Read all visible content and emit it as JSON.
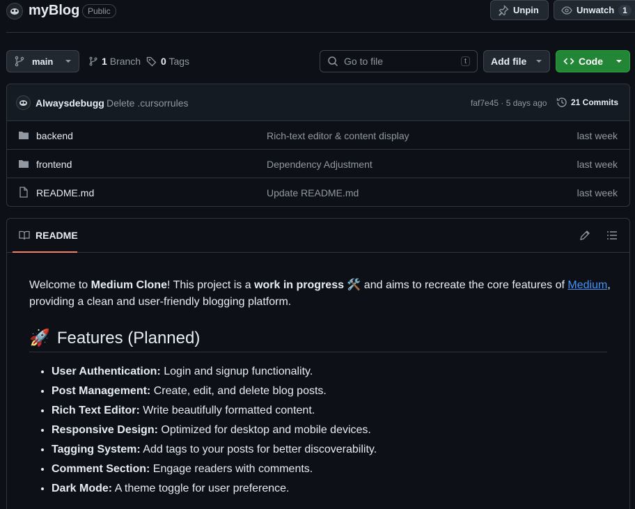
{
  "repo": {
    "name": "myBlog",
    "visibility": "Public",
    "unpin_label": "Unpin",
    "unwatch_label": "Unwatch",
    "watch_count": "1"
  },
  "toolbar": {
    "branch": "main",
    "branch_count": "1",
    "branch_word": "Branch",
    "tag_count": "0",
    "tag_word": "Tags",
    "search_placeholder": "Go to file",
    "search_shortcut": "t",
    "add_file_label": "Add file",
    "code_label": "Code"
  },
  "commit": {
    "author": "Alwaysdebugg",
    "message": "Delete .cursorrules",
    "hash_time": "faf7e45 · 5 days ago",
    "commits_label": "21 Commits"
  },
  "files": [
    {
      "name": "backend",
      "type": "folder",
      "message": "Rich-text editor & content display",
      "time": "last week"
    },
    {
      "name": "frontend",
      "type": "folder",
      "message": "Dependency Adjustment",
      "time": "last week"
    },
    {
      "name": "README.md",
      "type": "file",
      "message": "Update README.md",
      "time": "last week"
    }
  ],
  "readme": {
    "tab_label": "README",
    "intro": {
      "p1": "Welcome to ",
      "b1": "Medium Clone",
      "p2": "! This project is a ",
      "b2": "work in progress",
      "p3": " 🛠️ and aims to recreate the core features of ",
      "link": "Medium",
      "p4": ", providing a clean and user-friendly blogging platform."
    },
    "features_heading": "Features (Planned)",
    "features_emoji": "🚀",
    "features": [
      {
        "title": "User Authentication:",
        "desc": " Login and signup functionality."
      },
      {
        "title": "Post Management:",
        "desc": " Create, edit, and delete blog posts."
      },
      {
        "title": "Rich Text Editor:",
        "desc": " Write beautifully formatted content."
      },
      {
        "title": "Responsive Design:",
        "desc": " Optimized for desktop and mobile devices."
      },
      {
        "title": "Tagging System:",
        "desc": " Add tags to your posts for better discoverability."
      },
      {
        "title": "Comment Section:",
        "desc": " Engage readers with comments."
      },
      {
        "title": "Dark Mode:",
        "desc": " A theme toggle for user preference."
      }
    ]
  },
  "colors": {
    "background": "#0d1117",
    "accent_green": "#238636",
    "link": "#4493f8",
    "tab_underline": "#f78166"
  }
}
